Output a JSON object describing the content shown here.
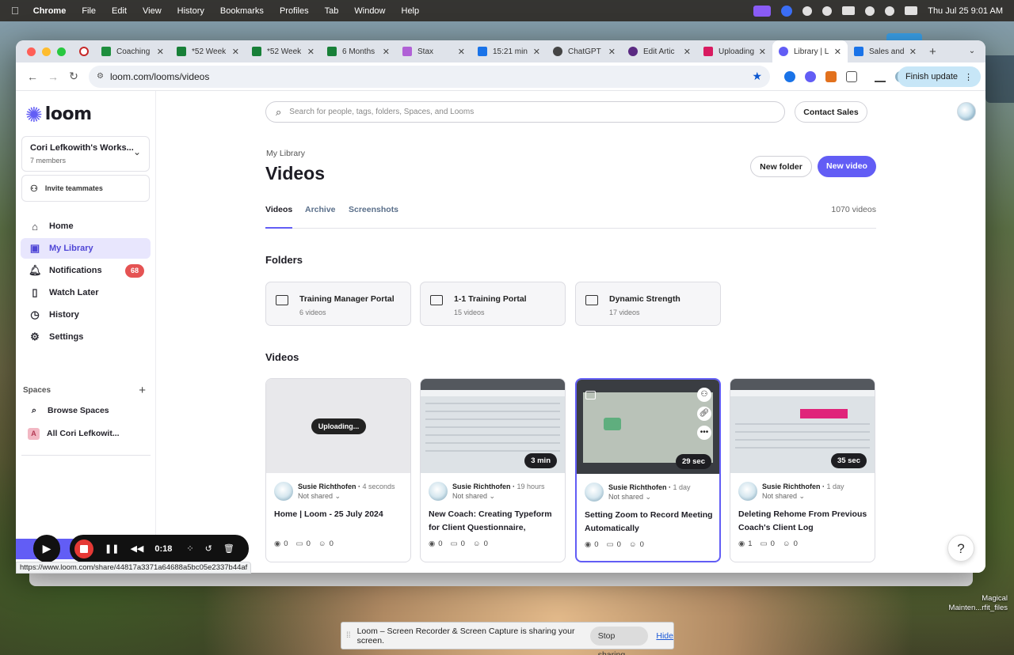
{
  "menubar": {
    "app": "Chrome",
    "items": [
      "File",
      "Edit",
      "View",
      "History",
      "Bookmarks",
      "Profiles",
      "Tab",
      "Window",
      "Help"
    ],
    "datetime": "Thu Jul 25  9:01 AM"
  },
  "tabs": [
    {
      "label": "Coaching",
      "color": "#1e8e3e"
    },
    {
      "label": "*52 Week",
      "color": "#188038"
    },
    {
      "label": "*52 Week",
      "color": "#188038"
    },
    {
      "label": "6 Months",
      "color": "#188038"
    },
    {
      "label": "Stax",
      "color": "#b061d6"
    },
    {
      "label": "15:21 min",
      "color": "#1a73e8"
    },
    {
      "label": "ChatGPT",
      "color": "#444444"
    },
    {
      "label": "Edit Artic",
      "color": "#5a2a82"
    },
    {
      "label": "Uploading",
      "color": "#d81b60"
    },
    {
      "label": "Library | L",
      "color": "#625df5"
    },
    {
      "label": "Sales and",
      "color": "#1a73e8"
    }
  ],
  "browser": {
    "url": "loom.com/looms/videos",
    "update_label": "Finish update",
    "status_url": "https://www.loom.com/share/44817a3371a64688a5bc05e2337b44af"
  },
  "brand": {
    "name": "loom",
    "accent": "#625df5"
  },
  "workspace": {
    "name": "Cori Lefkowith's Works...",
    "members": "7 members",
    "invite": "Invite teammates"
  },
  "nav": [
    {
      "label": "Home",
      "icon": "home-icon"
    },
    {
      "label": "My Library",
      "icon": "library-icon"
    },
    {
      "label": "Notifications",
      "icon": "bell-icon",
      "badge": "68"
    },
    {
      "label": "Watch Later",
      "icon": "bookmark-icon"
    },
    {
      "label": "History",
      "icon": "clock-icon"
    },
    {
      "label": "Settings",
      "icon": "gear-icon"
    }
  ],
  "spaces": {
    "header": "Spaces",
    "items": [
      {
        "label": "Browse Spaces",
        "icon": "search-icon"
      },
      {
        "label": "All Cori Lefkowit...",
        "avatar": "A"
      }
    ]
  },
  "search": {
    "placeholder": "Search for people, tags, folders, Spaces, and Looms"
  },
  "header": {
    "contact": "Contact Sales",
    "breadcrumb": "My Library",
    "title": "Videos",
    "new_folder": "New folder",
    "new_video": "New video"
  },
  "library_tabs": [
    "Videos",
    "Archive",
    "Screenshots"
  ],
  "video_count": "1070 videos",
  "sections": {
    "folders": "Folders",
    "videos": "Videos"
  },
  "folders": [
    {
      "name": "Training Manager Portal",
      "count": "6 videos"
    },
    {
      "name": "1-1 Training Portal",
      "count": "15 videos"
    },
    {
      "name": "Dynamic Strength",
      "count": "17 videos"
    }
  ],
  "videos": [
    {
      "author": "Susie Richthofen",
      "time": "4 seconds",
      "share": "Not shared",
      "title": "Home | Loom - 25 July 2024",
      "status": "Uploading...",
      "duration": "",
      "views": "0",
      "comments": "0",
      "reactions": "0"
    },
    {
      "author": "Susie Richthofen",
      "time": "19 hours",
      "share": "Not shared",
      "title": "New Coach: Creating Typeform for Client Questionnaire, Linkin...",
      "status": "",
      "duration": "3 min",
      "views": "0",
      "comments": "0",
      "reactions": "0"
    },
    {
      "author": "Susie Richthofen",
      "time": "1 day",
      "share": "Not shared",
      "title": "Setting Zoom to Record Meeting Automatically",
      "status": "",
      "duration": "29 sec",
      "views": "0",
      "comments": "0",
      "reactions": "0"
    },
    {
      "author": "Susie Richthofen",
      "time": "1 day",
      "share": "Not shared",
      "title": "Deleting Rehome From Previous Coach's Client Log",
      "status": "",
      "duration": "35 sec",
      "views": "1",
      "comments": "0",
      "reactions": "0"
    }
  ],
  "recorder": {
    "time": "0:18"
  },
  "share_bar": {
    "message": "Loom – Screen Recorder & Screen Capture is sharing your screen.",
    "stop": "Stop sharing",
    "hide": "Hide"
  },
  "dock_label": "Magical Mainten...rfit_files"
}
